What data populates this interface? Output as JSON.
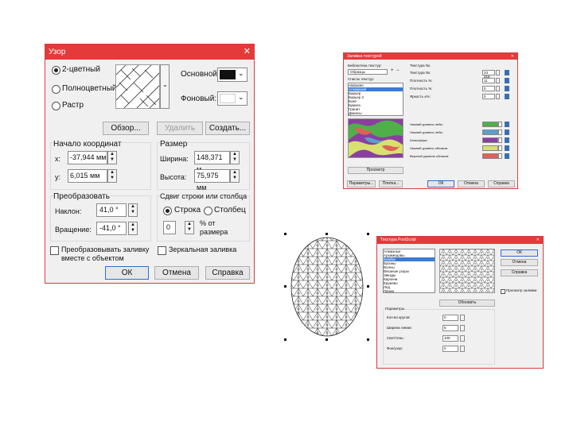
{
  "pattern": {
    "title": "Узор",
    "close": "✕",
    "type_2color": "2-цветный",
    "type_full": "Полноцветный",
    "type_raster": "Растр",
    "front_label": "Основной:",
    "back_label": "Фоновый:",
    "front_color": "#111111",
    "back_color": "#ffffff",
    "browse": "Обзор...",
    "delete": "Удалить",
    "create": "Создать...",
    "origin_title": "Начало координат",
    "x_label": "x:",
    "x_value": "-37,944 мм",
    "y_label": "y:",
    "y_value": "6,015 мм",
    "size_title": "Размер",
    "width_label": "Ширина:",
    "width_value": "148,371 м",
    "height_label": "Высота:",
    "height_value": "75,975 мм",
    "transform_title": "Преобразовать",
    "skew_label": "Наклон:",
    "skew_value": "41,0 °",
    "rotate_label": "Вращение:",
    "rotate_value": "-41,0 °",
    "shift_title": "Сдвиг строки или столбца",
    "row_label": "Строка",
    "col_label": "Столбец",
    "shift_value": "0",
    "shift_unit_1": "% от",
    "shift_unit_2": "размера",
    "transform_fill_1": "Преобразовывать заливку",
    "transform_fill_2": "вместе с объектом",
    "mirror_fill": "Зеркальная заливка",
    "ok": "ОК",
    "cancel": "Отмена",
    "help": "Справка"
  },
  "texture": {
    "title": "Заливка текстурой",
    "close": "✕",
    "library_label": "Библиотека текстур:",
    "library_value": "Образцы",
    "list_label": "Список текстур:",
    "items": [
      "Alabaster",
      "Алюминий",
      "Барьер",
      "Барьер 2",
      "Боке",
      "Бумага",
      "Гранит",
      "Джинсы"
    ],
    "selected_index": 1,
    "preview_button": "Просмотр",
    "params_title": "Текстура №:",
    "params": [
      {
        "label": "Текстура №:",
        "value": "23 416"
      },
      {
        "label": "Плотность %:",
        "value": "11"
      },
      {
        "label": "Плотность %:",
        "value": "0"
      },
      {
        "label": "Яркость ±%:",
        "value": "0"
      }
    ],
    "colors": [
      {
        "label": "Нижний уровень неба:",
        "color": "#4fb04a"
      },
      {
        "label": "Нижний уровень неба:",
        "color": "#5aa0c8"
      },
      {
        "label": "Атмосфера:",
        "color": "#8a3fa0"
      },
      {
        "label": "Нижний уровень облаков:",
        "color": "#d8e070"
      },
      {
        "label": "Верхний уровень облаков:",
        "color": "#e0605a"
      }
    ],
    "options_button": "Параметры...",
    "tiles_button": "Плитка...",
    "ok": "ОК",
    "cancel": "Отмена",
    "help": "Справка"
  },
  "postscript": {
    "title": "Текстура PostScript",
    "close": "✕",
    "items": [
      "Алмазные",
      "Архимедовы",
      "Бамбук",
      "Бусины",
      "Волны",
      "Вязаные узоры",
      "Звезды",
      "Кирпичи",
      "Кружево",
      "Лед",
      "Линии"
    ],
    "selected_index": 2,
    "refresh": "Обновить",
    "params_title": "Параметры",
    "params": [
      {
        "label": "Кол-во кругов:",
        "value": "0"
      },
      {
        "label": "Ширина линии:",
        "value": "5"
      },
      {
        "label": "Свет/тень:",
        "value": "100"
      },
      {
        "label": "Фон/узор:",
        "value": "0"
      }
    ],
    "ok": "ОК",
    "cancel": "Отмена",
    "help": "Справка",
    "preview_fill": "Просмотр заливки"
  }
}
